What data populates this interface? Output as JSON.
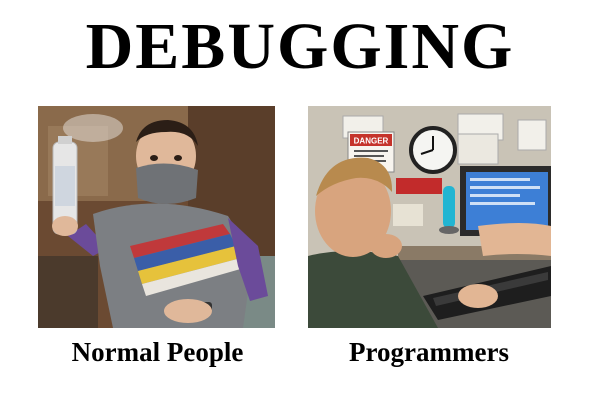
{
  "title": "DEBUGGING",
  "panels": [
    {
      "caption": "Normal People",
      "label_desc": "man spraying air freshener while covering nose with shirt"
    },
    {
      "caption": "Programmers",
      "label_desc": "man at computer desk leaning in focused",
      "sign_text": "DANGER"
    }
  ],
  "colors": {
    "text": "#000000",
    "background": "#ffffff",
    "shirt_gray": "#7c7f83",
    "stripe_red": "#c0393b",
    "stripe_blue": "#3a5ea8",
    "stripe_yellow": "#e6c23b",
    "sleeve_purple": "#6b4b9a",
    "lamp_teal": "#22b5d2",
    "screen_blue": "#3d7fd6"
  }
}
